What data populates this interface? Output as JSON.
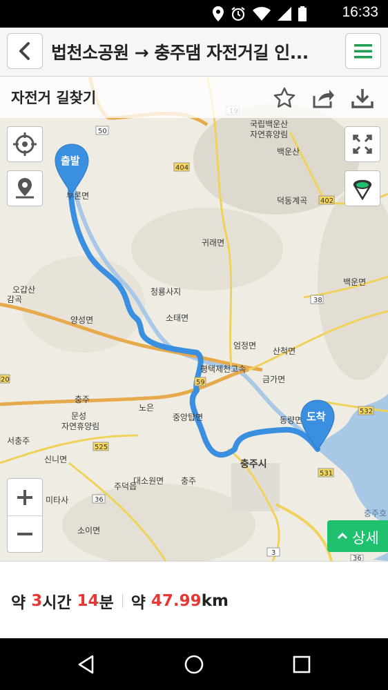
{
  "status_bar": {
    "time": "16:33"
  },
  "header": {
    "title": "법천소공원 → 충주댐 자전거길 인..."
  },
  "route_header": {
    "label": "자전거 길찾기"
  },
  "map": {
    "start_label": "출발",
    "end_label": "도착",
    "detail_label": "상세",
    "labels": [
      {
        "key": "l1",
        "text": "국립백운산"
      },
      {
        "key": "l2",
        "text": "자연휴양림"
      },
      {
        "key": "l3",
        "text": "백운산"
      },
      {
        "key": "l4",
        "text": "덕동계곡"
      },
      {
        "key": "l5",
        "text": "귀래면"
      },
      {
        "key": "l6",
        "text": "백운면"
      },
      {
        "key": "l7",
        "text": "오갑산"
      },
      {
        "key": "l8",
        "text": "감곡"
      },
      {
        "key": "l9",
        "text": "청룡사지"
      },
      {
        "key": "l10",
        "text": "소태면"
      },
      {
        "key": "l11",
        "text": "양성면"
      },
      {
        "key": "l12",
        "text": "엄정면"
      },
      {
        "key": "l13",
        "text": "산척면"
      },
      {
        "key": "l14",
        "text": "평택제천고속"
      },
      {
        "key": "l15",
        "text": "금가면"
      },
      {
        "key": "l16",
        "text": "동량면"
      },
      {
        "key": "l17",
        "text": "중앙탑면"
      },
      {
        "key": "l18",
        "text": "충주"
      },
      {
        "key": "l19",
        "text": "노은"
      },
      {
        "key": "l20",
        "text": "문성"
      },
      {
        "key": "l21",
        "text": "자연휴양림"
      },
      {
        "key": "l22",
        "text": "서충주"
      },
      {
        "key": "l23",
        "text": "신니면"
      },
      {
        "key": "l24",
        "text": "충주시"
      },
      {
        "key": "l25",
        "text": "대소원면"
      },
      {
        "key": "l26",
        "text": "충주"
      },
      {
        "key": "l27",
        "text": "주덕읍"
      },
      {
        "key": "l28",
        "text": "미타사"
      },
      {
        "key": "l29",
        "text": "소이면"
      },
      {
        "key": "l30",
        "text": "충주호"
      },
      {
        "key": "l31",
        "text": "부론면"
      }
    ],
    "route_numbers": [
      "50",
      "404",
      "19",
      "402",
      "38",
      "532",
      "531",
      "525",
      "36",
      "3",
      "36",
      "20",
      "59"
    ]
  },
  "summary": {
    "prefix": "약",
    "hours": "3",
    "hours_unit": "시간",
    "minutes": "14",
    "minutes_unit": "분",
    "distance_prefix": "약",
    "distance": "47.99",
    "distance_unit": "km"
  },
  "colors": {
    "route": "#3b8fe0",
    "detail_button": "#1fc16e",
    "accent_red": "#e53935",
    "menu_green": "#1e9e4f"
  },
  "icons": [
    "location-icon",
    "alarm-icon",
    "wifi-icon",
    "signal-icon",
    "battery-icon",
    "back-icon",
    "menu-icon",
    "star-icon",
    "share-icon",
    "download-icon",
    "locate-icon",
    "pin-icon",
    "fullscreen-icon",
    "marker-icon",
    "chevron-up-icon",
    "back-nav-icon",
    "home-nav-icon",
    "recents-nav-icon"
  ]
}
